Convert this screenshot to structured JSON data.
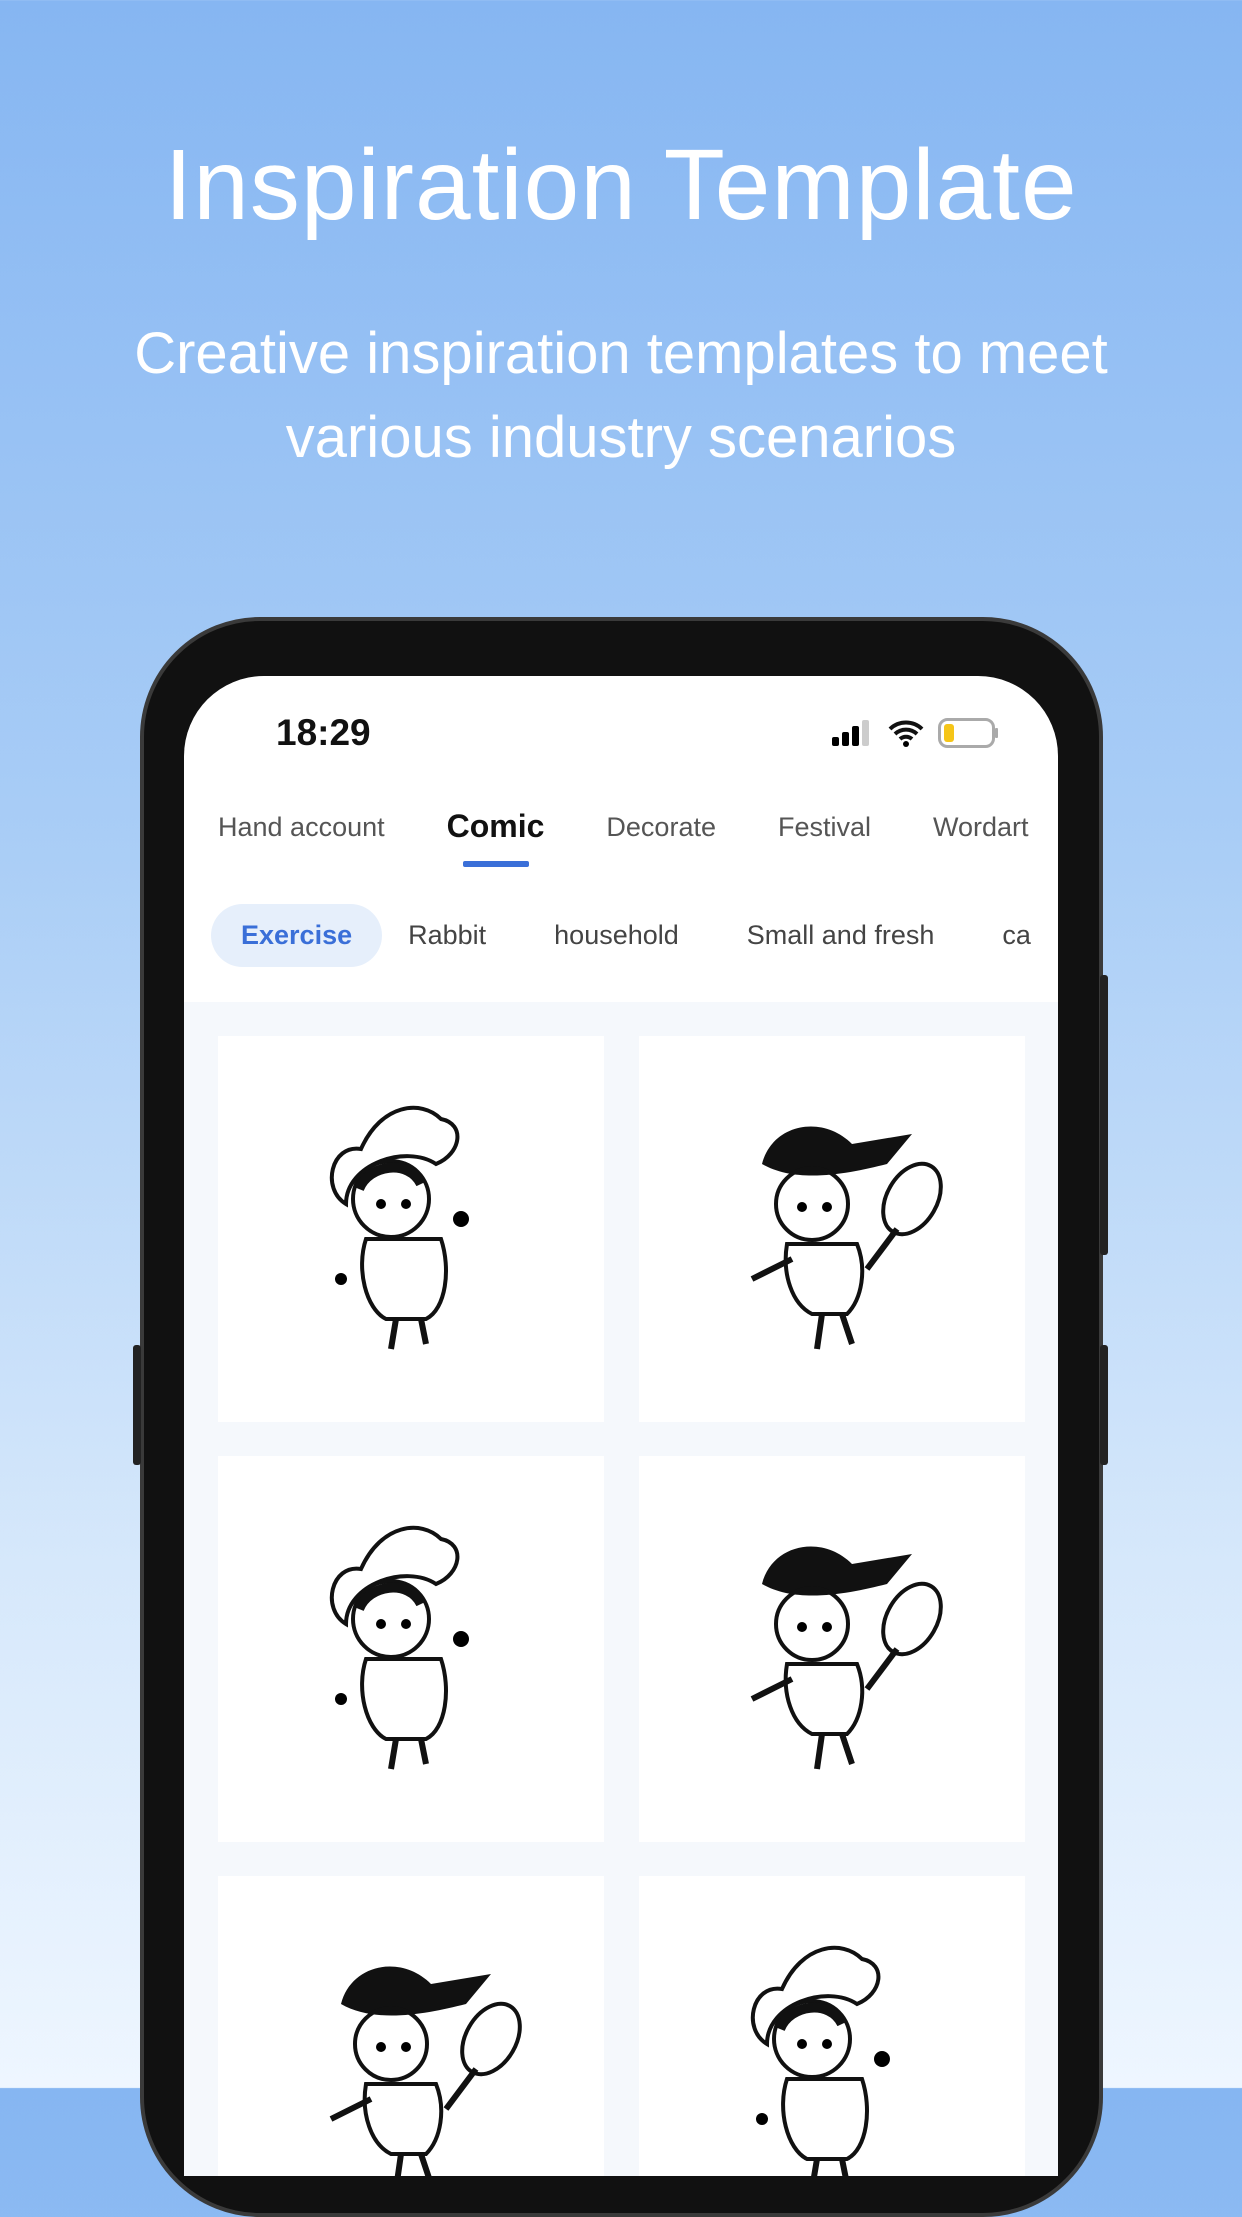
{
  "hero": {
    "title": "Inspiration Template",
    "subtitle": "Creative inspiration templates to meet various industry scenarios"
  },
  "status_bar": {
    "time": "18:29",
    "icons": [
      "signal-icon",
      "wifi-icon",
      "battery-icon"
    ],
    "battery_color": "#f5c518"
  },
  "tabs": [
    {
      "label": "Hand account"
    },
    {
      "label": "Comic",
      "active": true
    },
    {
      "label": "Decorate"
    },
    {
      "label": "Festival"
    },
    {
      "label": "Wordart"
    }
  ],
  "chips": [
    {
      "label": "Exercise",
      "active": true
    },
    {
      "label": "Rabbit"
    },
    {
      "label": "household"
    },
    {
      "label": "Small and fresh"
    },
    {
      "label": "ca"
    }
  ],
  "accent": "#3a6fd8",
  "templates": [
    {
      "subject": "chef"
    },
    {
      "subject": "tennis"
    },
    {
      "subject": "chef"
    },
    {
      "subject": "tennis"
    },
    {
      "subject": "tennis"
    },
    {
      "subject": "chef"
    }
  ]
}
